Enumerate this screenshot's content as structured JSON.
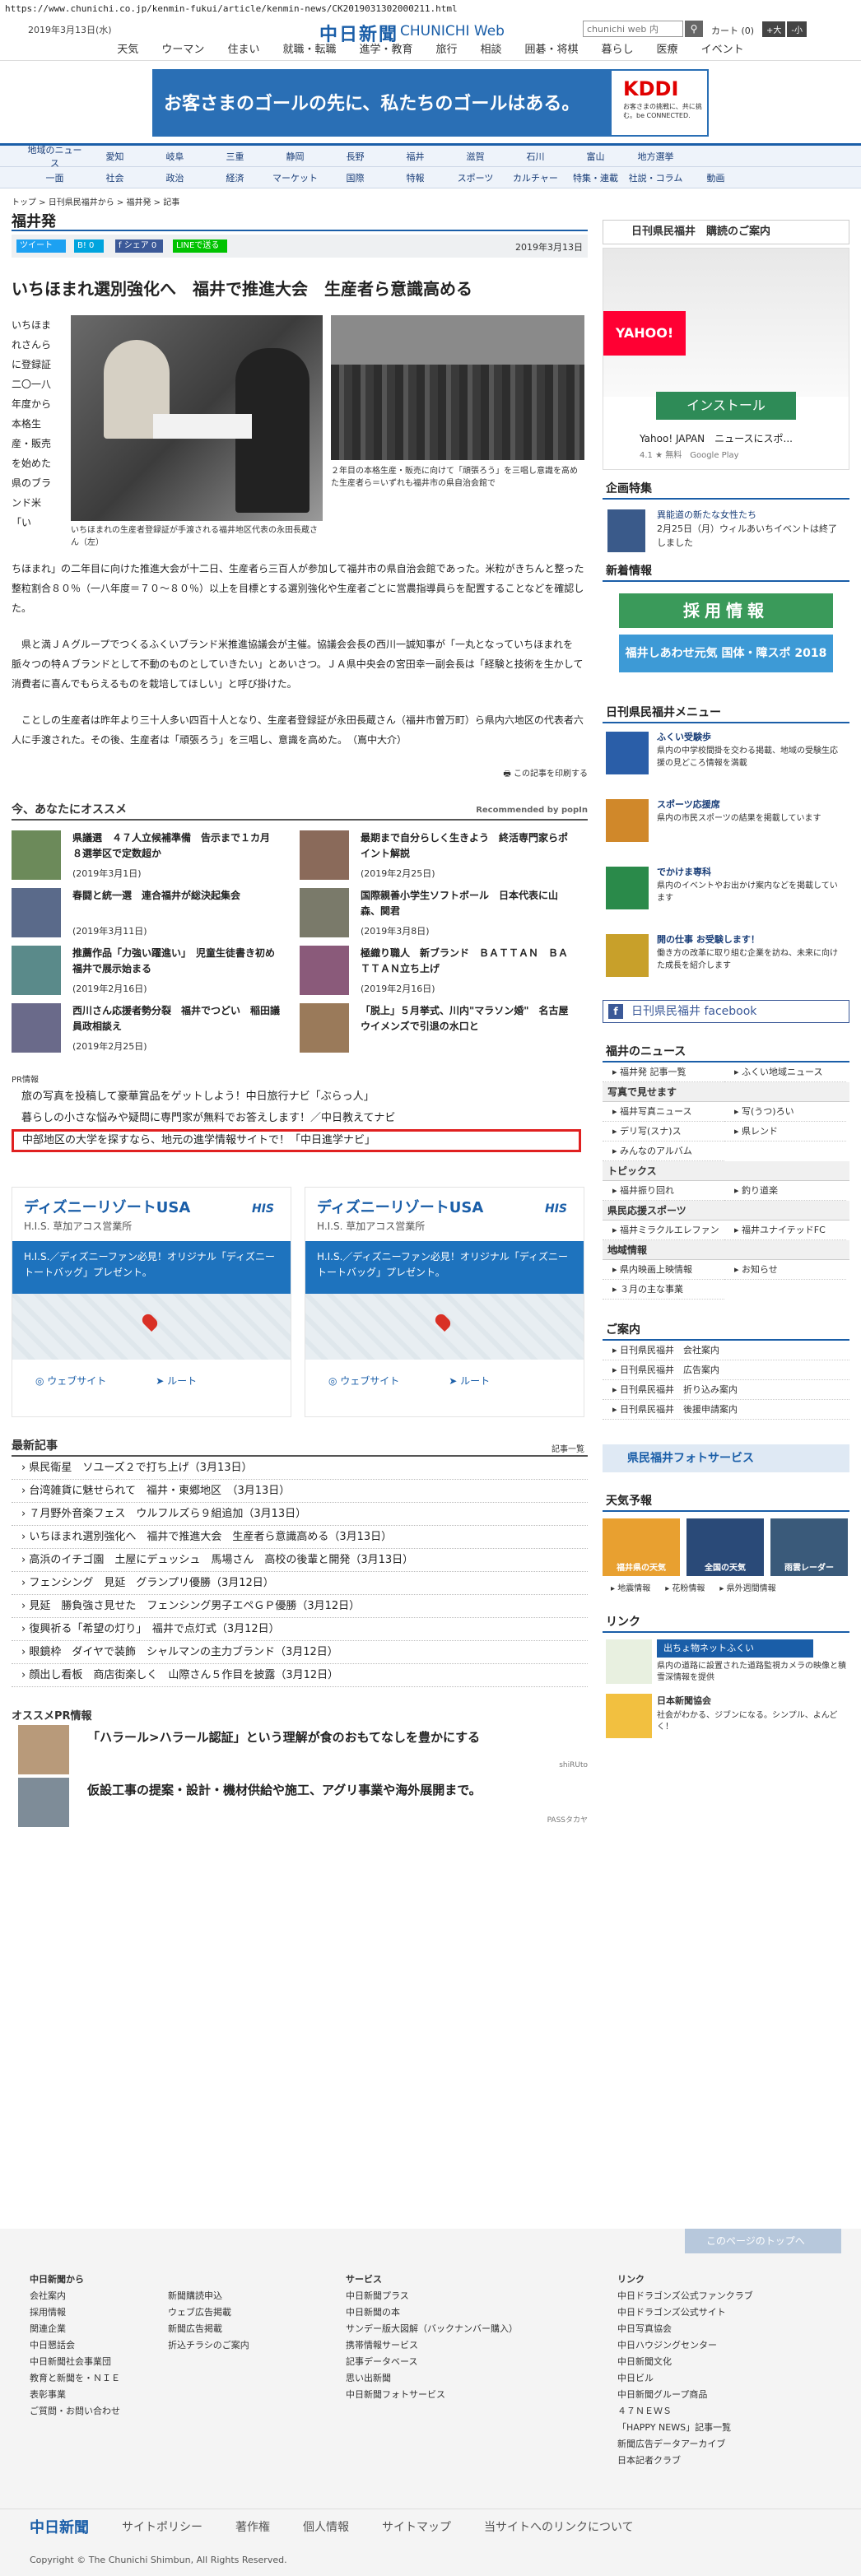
{
  "url": "https://www.chunichi.co.jp/kenmin-fukui/article/kenmin-news/CK2019031302000211.html",
  "header": {
    "date": "2019年3月13日(水)",
    "logo": "中日新聞",
    "logo_sub": "CHUNICHI Web",
    "search_placeholder": "chunichi web 内",
    "cart": "カート (0)",
    "font_large": "+大",
    "font_small": "-小"
  },
  "nav1": [
    "天気",
    "ウーマン",
    "住まい",
    "就職・転職",
    "進学・教育",
    "旅行",
    "相談",
    "囲碁・将棋",
    "暮らし",
    "医療",
    "イベント"
  ],
  "banner": {
    "text": "お客さまのゴールの先に、私たちのゴールはある。",
    "brand": "KDDI",
    "sub": "お客さまの挑戦に、共に挑む。be CONNECTED."
  },
  "nav2": {
    "row1": [
      "地域のニュース",
      "愛知",
      "岐阜",
      "三重",
      "静岡",
      "長野",
      "福井",
      "滋賀",
      "石川",
      "富山",
      "地方選挙"
    ],
    "row2": [
      "一面",
      "社会",
      "政治",
      "経済",
      "マーケット",
      "国際",
      "特報",
      "スポーツ",
      "カルチャー",
      "特集・連載",
      "社説・コラム",
      "動画"
    ]
  },
  "breadcrumb": "トップ > 日刊県民福井から > 福井発 > 記事",
  "section_title": "福井発",
  "share": {
    "tweet": "ツイート",
    "hatena": "B! 0",
    "facebook": "f シェア 0",
    "line": "LINEで送る",
    "date": "2019年3月13日"
  },
  "article": {
    "headline": "いちほまれ選別強化へ　福井で推進大会　生産者ら意識高める",
    "side_text": "いちほまれさんらに登録証 二〇一八年度から本格生産・販売を始めた県のブランド米「い",
    "caption1": "いちほまれの生産者登録証が手渡される福井地区代表の永田長蔵さん（左）",
    "caption2": "２年目の本格生産・販売に向けて「頑張ろう」を三唱し意識を高めた生産者ら＝いずれも福井市の県自治会館で",
    "p1": "ちほまれ」の二年目に向けた推進大会が十二日、生産者ら三百人が参加して福井市の県自治会館であった。米粒がきちんと整った整粒割合８０％（一八年度＝７０～８０％）以上を目標とする選別強化や生産者ごとに営農指導員らを配置することなどを確認した。",
    "p2": "県と満ＪＡグループでつくるふくいブランド米推進協議会が主催。協議会会長の西川一誠知事が「一丸となっていちほまれを脈々つの特Ａブランドとして不動のものとしていきたい」とあいさつ。ＪＡ県中央会の宮田幸一副会長は「経験と技術を生かして消費者に喜んでもらえるものを栽培してほしい」と呼び掛けた。",
    "p3": "ことしの生産者は昨年より三十人多い四百十人となり、生産者登録証が永田長蔵さん（福井市曽万町）ら県内六地区の代表者六人に手渡された。その後、生産者は「頑張ろう」を三唱し、意識を高めた。　（嶌中大介）",
    "print": "この記事を印刷する"
  },
  "reco": {
    "title": "今、あなたにオススメ",
    "popin": "Recommended by popIn",
    "items": [
      {
        "text": "県議選　４７人立候補準備　告示まで１カ月　８選挙区で定数超か",
        "date": "(2019年3月1日)"
      },
      {
        "text": "最期まで自分らしく生きよう　終活専門家らポイント解説",
        "date": "(2019年2月25日)"
      },
      {
        "text": "春闘と統一選　連合福井が総決起集会",
        "date": "(2019年3月11日)"
      },
      {
        "text": "国際親善小学生ソフトボール　日本代表に山森、関君",
        "date": "(2019年3月8日)"
      },
      {
        "text": "推薦作品「力強い躍進い」　児童生徒書き初め　福井で展示始まる",
        "date": "(2019年2月16日)"
      },
      {
        "text": "極織り職人　新ブランド　ＢＡＴＴＡＮ　ＢＡＴＴＡＮ立ち上げ",
        "date": "(2019年2月16日)"
      },
      {
        "text": "西川さん応援者勢分裂　福井でつどい　稲田議員政相談え",
        "date": "(2019年2月25日)"
      },
      {
        "text": "「脱上」５月挙式、川内\"マラソン婚\"　名古屋ウイメンズで引退の水口と",
        "date": ""
      }
    ]
  },
  "pr": {
    "label": "PR情報",
    "items": [
      "旅の写真を投稿して豪華賞品をゲットしよう！中日旅行ナビ「ぶらっ人」",
      "暮らしの小さな悩みや疑問に専門家が無料でお答えします！／中日教えてナビ",
      "中部地区の大学を探すなら、地元の進学情報サイトで！「中日進学ナビ」"
    ]
  },
  "ads": [
    {
      "title": "ディズニーリゾートUSA",
      "his": "HIS",
      "sub": "H.I.S. 草加アコス営業所",
      "blue": "H.I.S.／ディズニーファン必見！オリジナル「ディズニートートバッグ」プレゼント。",
      "web": "ウェブサイト",
      "route": "ルート"
    },
    {
      "title": "ディズニーリゾートUSA",
      "his": "HIS",
      "sub": "H.I.S. 草加アコス営業所",
      "blue": "H.I.S.／ディズニーファン必見！オリジナル「ディズニートートバッグ」プレゼント。",
      "web": "ウェブサイト",
      "route": "ルート"
    }
  ],
  "news": {
    "title": "最新記事",
    "more": "記事一覧",
    "items": [
      "県民衛星　ソユーズ２で打ち上げ（3月13日）",
      "台湾雑貨に魅せられて　福井・東郷地区　（3月13日）",
      "７月野外音楽フェス　ウルフルズら９組追加（3月13日）",
      "いちほまれ選別強化へ　福井で推進大会　生産者ら意識高める（3月13日）",
      "高浜のイチゴ園　土屋にデュッシュ　馬場さん　高校の後輩と開発（3月13日）",
      "フェンシング　見延　グランプリ優勝（3月12日）",
      "見延　勝負強さ見せた　フェンシング男子エペＧＰ優勝（3月12日）",
      "復興祈る「希望の灯り」　福井で点灯式（3月12日）",
      "眼鏡枠　ダイヤで装飾　シャルマンの主力ブランド（3月12日）",
      "顔出し看板　商店街楽しく　山際さん５作目を披露（3月12日）"
    ]
  },
  "osusume": {
    "title": "オススメPR情報",
    "items": [
      {
        "text": "「ハラール>ハラール認証」という理解が食のおもてなしを豊かにする",
        "src": "shiRUto"
      },
      {
        "text": "仮設工事の提案・設計・機材供給や施工、アグリ事業や海外展開まで。",
        "src": "PASSタカヤ"
      }
    ]
  },
  "right": {
    "subscribe": "日刊県民福井　購読のご案内",
    "yahoo_title": "Yahoo! JAPAN　ニュースにスポ...",
    "yahoo_install": "インストール",
    "yahoo_rating": "4.1 ★ 無料　Google Play",
    "tokushu_title": "企画特集",
    "tokushu_text": "2月25日（月）ウィルあいちイベントは終了しました",
    "tokushu_sub": "異能道の新たな女性たち",
    "shincho_title": "新着情報",
    "saiyo": "採用情報",
    "fukui_sports": "福井しあわせ元気 国体・障スポ 2018",
    "menu_title": "日刊県民福井メニュー",
    "menu": [
      {
        "h": "ふくい受験歩",
        "t": "県内の中学校間掛を交わる掲載、地域の受験生応援の見どころ情報を満載"
      },
      {
        "h": "スポーツ応援席",
        "t": "県内の市民スポーツの結果を掲載しています"
      },
      {
        "h": "でかけま専科",
        "t": "県内のイベントやお出かけ案内などを掲載しています"
      },
      {
        "h": "開の仕事 お受験します！",
        "t": "働き方の改革に取り組む企業を訪ね、未来に向けた成長を紹介します"
      }
    ],
    "facebook": "日刊県民福井 facebook",
    "fukui_news": "福井のニュース",
    "fukui_news_items": [
      "福井発 記事一覧",
      "ふくい地域ニュース"
    ],
    "photo_title": "写真で見せます",
    "photo_items": [
      "福井写真ニュース",
      "写(うつ)ろい",
      "デリ写(スナ)ス",
      "県レンド",
      "みんなのアルバム"
    ],
    "topics": "トピックス",
    "topics_items": [
      "福井振り回れ",
      "釣り道楽"
    ],
    "sports": "県民応援スポーツ",
    "sports_items": [
      "福井ミラクルエレファンツ",
      "福井ユナイテッドFC"
    ],
    "chiiki": "地域情報",
    "chiiki_items": [
      "県内映画上映情報",
      "お知らせ",
      "３月の主な事業"
    ],
    "annai": "ご案内",
    "annai_items": [
      "日刊県民福井　会社案内",
      "日刊県民福井　広告案内",
      "日刊県民福井　折り込み案内",
      "日刊県民福井　後援申請案内"
    ],
    "photo_service": "県民福井フォトサービス",
    "weather_title": "天気予報",
    "weather": [
      "福井県の天気",
      "全国の天気",
      "雨雲レーダー"
    ],
    "weather_links": [
      "地震情報",
      "花粉情報",
      "県外週間情報"
    ],
    "link_title": "リンク",
    "link1": "出ちょ物ネットふくい",
    "link1_text": "県内の道路に設置された道路監視カメラの映像と積雪深情報を提供",
    "link2": "日本新聞協会",
    "link2_text": "社会がわかる、ジブンになる。シンプル、よんどく！"
  },
  "footer": {
    "page_top": "このページのトップへ",
    "col1": [
      "中日新聞から",
      "会社案内",
      "採用情報",
      "関連企業",
      "中日懇話会",
      "中日新聞社会事業団",
      "教育と新聞を・ＮＩＥ",
      "表彰事業",
      "ご質問・お問い合わせ"
    ],
    "col2": [
      "新聞購読申込",
      "ウェブ広告掲載",
      "新聞広告掲載",
      "折込チラシのご案内"
    ],
    "col3": [
      "サービス",
      "中日新聞プラス",
      "中日新聞の本",
      "サンデー版大図解（バックナンバー購入）",
      "携帯情報サービス",
      "記事データベース",
      "思い出新聞",
      "中日新聞フォトサービス"
    ],
    "col4": [
      "リンク",
      "中日ドラゴンズ公式ファンクラブ",
      "中日ドラゴンズ公式サイト",
      "中日写真協会",
      "中日ハウジングセンター",
      "中日新聞文化",
      "中日ビル",
      "中日新聞グループ商品",
      "４７ＮＥＷＳ",
      "「HAPPY NEWS」記事一覧",
      "新聞広告データアーカイブ",
      "日本記者クラブ"
    ],
    "logo": "中日新聞",
    "bar": [
      "サイトポリシー",
      "著作権",
      "個人情報",
      "サイトマップ",
      "当サイトへのリンクについて"
    ],
    "copyright": "Copyright © The Chunichi Shimbun, All Rights Reserved."
  }
}
